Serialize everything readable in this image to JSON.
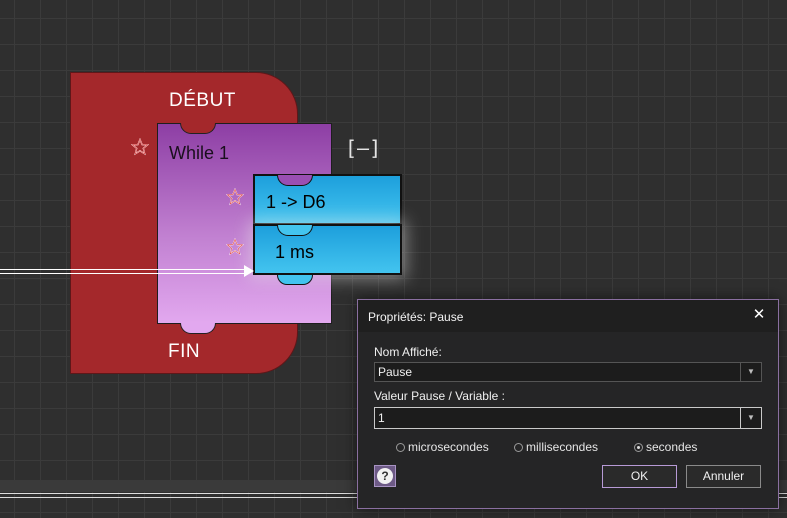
{
  "canvas": {
    "colors": {
      "grid_bg": "#2f2f2f",
      "debut_block": "#a4282b",
      "while_block_top": "#8d3ea4",
      "while_block_bottom": "#e2a8ef",
      "cmd_block_top": "#1d9fdc",
      "cmd_block_bottom": "#43c4ef"
    },
    "debut_block": {
      "start_label": "DÉBUT",
      "end_label": "FIN"
    },
    "while_block": {
      "label": "While 1",
      "collapse_label": "[–]"
    },
    "blocks": [
      {
        "label": "1 -> D6"
      },
      {
        "label": "1 ms"
      }
    ],
    "icons": {
      "breakpoint": "star-icon",
      "wire": "arrow-right-icon"
    }
  },
  "dialog": {
    "title": "Propriétés: Pause",
    "close_glyph": "✕",
    "fields": {
      "display_name": {
        "label": "Nom Affiché:",
        "value": "Pause"
      },
      "pause_value": {
        "label": "Valeur Pause / Variable :",
        "value": "1"
      }
    },
    "units": {
      "options": [
        "microsecondes",
        "millisecondes",
        "secondes"
      ],
      "selected": "secondes"
    },
    "help_glyph": "?",
    "ok_label": "OK",
    "cancel_label": "Annuler",
    "accent_color": "#8a6fa0"
  }
}
